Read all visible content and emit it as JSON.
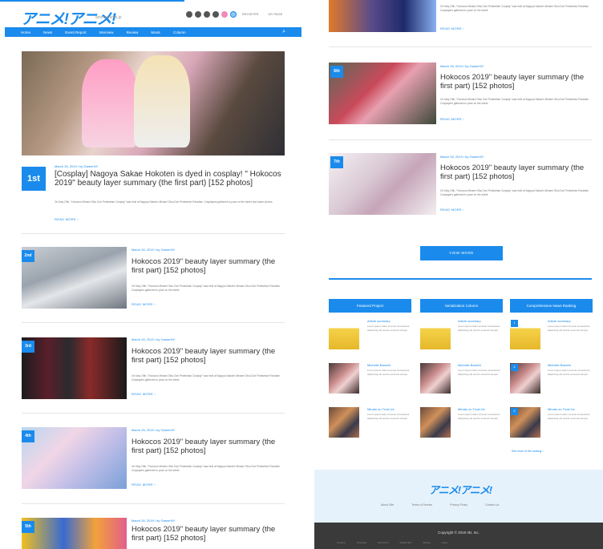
{
  "header": {
    "logo": "アニメ!アニメ!",
    "logo_sub": "animeanime.jp",
    "links": [
      "REGISTER",
      "MY PAGE"
    ]
  },
  "nav": {
    "items": [
      "Home",
      "News",
      "Event Report",
      "Interview",
      "Review",
      "Music",
      "Column"
    ]
  },
  "articles": [
    {
      "rank": "1st",
      "meta": "March 26, 2019 / by GamerNY",
      "title": "[Cosplay] Nagoya Sakae Hokoten is dyed in cosplay! \" Hokocos 2019\" beauty layer summary (the first part) [152 photos]",
      "desc": "On May 19th, \"Hokocos Minami Otsu Dori Pedestrian Cosplay\" was held at Nagoya Sakae's Minami Otsu Dori Pedestrian Paradise. Cosplayers gathered to pose on the street and share photos.",
      "more": "READ MORE ›"
    },
    {
      "rank": "2nd",
      "meta": "March 26, 2019 / by GamerNY",
      "title": "Hokocos 2019\" beauty layer summary (the first part) [152 photos]",
      "desc": "On May 19th, \"Hokocos Minami Otsu Dori Pedestrian Cosplay\" was held at Nagoya Sakae's Minami Otsu Dori Pedestrian Paradise. Cosplayers gathered to pose on the street.",
      "more": "READ MORE ›"
    },
    {
      "rank": "3rd",
      "meta": "March 26, 2019 / by GamerNY",
      "title": "Hokocos 2019\" beauty layer summary (the first part) [152 photos]",
      "desc": "On May 19th, \"Hokocos Minami Otsu Dori Pedestrian Cosplay\" was held at Nagoya Sakae's Minami Otsu Dori Pedestrian Paradise. Cosplayers gathered to pose on the street.",
      "more": "READ MORE ›"
    },
    {
      "rank": "4th",
      "meta": "March 26, 2019 / by GamerNY",
      "title": "Hokocos 2019\" beauty layer summary (the first part) [152 photos]",
      "desc": "On May 19th, \"Hokocos Minami Otsu Dori Pedestrian Cosplay\" was held at Nagoya Sakae's Minami Otsu Dori Pedestrian Paradise. Cosplayers gathered to pose on the street.",
      "more": "READ MORE ›"
    },
    {
      "rank": "5th",
      "meta": "March 26, 2019 / by GamerNY",
      "title": "Hokocos 2019\" beauty layer summary (the first part) [152 photos]"
    }
  ],
  "right_articles": [
    {
      "desc": "On May 19th, \"Hokocos Minami Otsu Dori Pedestrian Cosplay\" was held at Nagoya Sakae's Minami Otsu Dori Pedestrian Paradise. Cosplayers gathered to pose on the street.",
      "more": "READ MORE ›"
    },
    {
      "rank": "6th",
      "meta": "March 26, 2019 / by GamerNY",
      "title": "Hokocos 2019\" beauty layer summary (the first part) [152 photos]",
      "desc": "On May 19th, \"Hokocos Minami Otsu Dori Pedestrian Cosplay\" was held at Nagoya Sakae's Minami Otsu Dori Pedestrian Paradise. Cosplayers gathered to pose on the street.",
      "more": "READ MORE ›"
    },
    {
      "rank": "7th",
      "meta": "March 26, 2019 / by GamerNY",
      "title": "Hokocos 2019\" beauty layer summary (the first part) [152 photos]",
      "desc": "On May 19th, \"Hokocos Minami Otsu Dori Pedestrian Cosplay\" was held at Nagoya Sakae's Minami Otsu Dori Pedestrian Paradise. Cosplayers gathered to pose on the street.",
      "more": "READ MORE ›"
    }
  ],
  "view_more": "VIEW MORE",
  "columns": [
    {
      "head": "Featured Project",
      "items": [
        {
          "title": "Article summary",
          "desc": "Lorem ipsum dolor sit amet consectetur adipiscing elit sed do eiusmod tempor"
        },
        {
          "title": "Michelle Barnett",
          "desc": "Lorem ipsum dolor sit amet consectetur adipiscing elit sed do eiusmod tempor"
        },
        {
          "title": "Minato on Trust Us",
          "desc": "Lorem ipsum dolor sit amet consectetur adipiscing elit sed do eiusmod tempor"
        }
      ]
    },
    {
      "head": "Serialization Column",
      "items": [
        {
          "title": "Article summary",
          "desc": "Lorem ipsum dolor sit amet consectetur adipiscing elit sed do eiusmod tempor"
        },
        {
          "title": "Michelle Barnett",
          "desc": "Lorem ipsum dolor sit amet consectetur adipiscing elit sed do eiusmod tempor"
        },
        {
          "title": "Minato on Trust Us",
          "desc": "Lorem ipsum dolor sit amet consectetur adipiscing elit sed do eiusmod tempor"
        }
      ]
    },
    {
      "head": "Comprehensive News Ranking",
      "items": [
        {
          "rank": "1",
          "title": "Article summary",
          "desc": "Lorem ipsum dolor sit amet consectetur adipiscing elit sed do eiusmod tempor"
        },
        {
          "rank": "2",
          "title": "Michelle Barnett",
          "desc": "Lorem ipsum dolor sit amet consectetur adipiscing elit sed do eiusmod tempor"
        },
        {
          "rank": "3",
          "title": "Minato on Trust Us",
          "desc": "Lorem ipsum dolor sit amet consectetur adipiscing elit sed do eiusmod tempor"
        }
      ]
    }
  ],
  "see_all": "See more of the ranking ›",
  "footer": {
    "logo": "アニメ!アニメ!",
    "links": [
      "About Site",
      "Terms of Service",
      "Privacy Policy",
      "Contact Us"
    ],
    "copyright": "Copyright © 2019 IID, Inc.",
    "tiny_links": [
      "Company",
      "Advertising",
      "Recruitment",
      "Related Sites",
      "Sitemap",
      "Inquiry"
    ]
  },
  "colors": {
    "accent": "#1a8bec",
    "footer_bg": "#e6f2fb",
    "bottom_bg": "#3a3a3a"
  }
}
